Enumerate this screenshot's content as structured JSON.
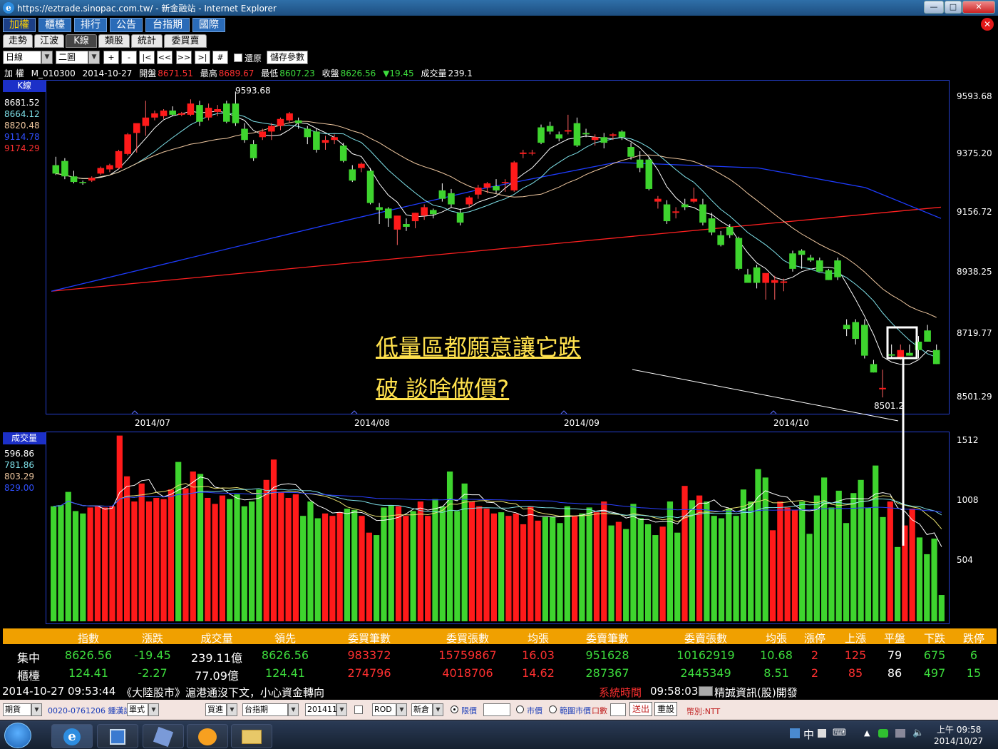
{
  "window": {
    "title": "https://eztrade.sinopac.com.tw/ - 新金融站 - Internet Explorer",
    "buttons": [
      "—",
      "□",
      "✕"
    ]
  },
  "main_tabs": [
    "加權",
    "櫃檯",
    "排行",
    "公告",
    "台指期",
    "國際"
  ],
  "sub_tabs": [
    "走勢",
    "江波",
    "K線",
    "類股",
    "統計",
    "委買賣"
  ],
  "toolbar": {
    "period": "日線",
    "layout": "二圖",
    "nav_buttons": [
      "+",
      "-",
      "|<",
      "<<",
      ">>",
      ">|",
      "#"
    ],
    "restore_label": "還原",
    "save_label": "儲存參數"
  },
  "info": {
    "name": "加 權",
    "code": "M_010300",
    "date": "2014-10-27",
    "open_label": "開盤",
    "open": "8671.51",
    "high_label": "最高",
    "high": "8689.67",
    "low_label": "最低",
    "low": "8607.23",
    "close_label": "收盤",
    "close": "8626.56",
    "change": "▼19.45",
    "vol_label": "成交量",
    "vol": "239.1"
  },
  "kline": {
    "label": "K線",
    "ma": [
      {
        "value": "8681.52",
        "color": "#ffffff"
      },
      {
        "value": "8664.12",
        "color": "#7ee0e8"
      },
      {
        "value": "8820.48",
        "color": "#f0c8a0"
      },
      {
        "value": "9114.78",
        "color": "#3050ff"
      },
      {
        "value": "9174.29",
        "color": "#ff3030"
      }
    ],
    "y_ticks": [
      "9593.68",
      "9375.20",
      "9156.72",
      "8938.25",
      "8719.77",
      "8501.29"
    ],
    "x_ticks": [
      "2014/07",
      "2014/08",
      "2014/09",
      "2014/10"
    ],
    "max_label": "9593.68",
    "min_label": "8501.2"
  },
  "volume": {
    "label": "成交量",
    "ma": [
      {
        "value": "596.86",
        "color": "#ffffff"
      },
      {
        "value": "781.86",
        "color": "#7ee0e8"
      },
      {
        "value": "803.29",
        "color": "#f0c8a0"
      },
      {
        "value": "829.00",
        "color": "#3050ff"
      }
    ],
    "y_ticks": [
      "1512",
      "1008",
      "504"
    ]
  },
  "annotation": {
    "line1": "低量區都願意讓它跌",
    "line2": "破 談啥做價?"
  },
  "stats": {
    "headers": [
      "指數",
      "漲跌",
      "成交量",
      "領先",
      "委買筆數",
      "委買張數",
      "均張",
      "委賣筆數",
      "委賣張數",
      "均張",
      "漲停",
      "上漲",
      "平盤",
      "下跌",
      "跌停"
    ],
    "rows": [
      {
        "name": "集中",
        "cells": [
          "8626.56",
          "-19.45",
          "239.11億",
          "8626.56",
          "983372",
          "15759867",
          "16.03",
          "951628",
          "10162919",
          "10.68",
          "2",
          "125",
          "79",
          "675",
          "6"
        ]
      },
      {
        "name": "櫃檯",
        "cells": [
          "124.41",
          "-2.27",
          "77.09億",
          "124.41",
          "274796",
          "4018706",
          "14.62",
          "287367",
          "2445349",
          "8.51",
          "2",
          "85",
          "86",
          "497",
          "15"
        ]
      }
    ]
  },
  "news": {
    "time": "2014-10-27 09:53:44",
    "text": "《大陸股市》滬港通沒下文，小心資金轉向",
    "sys_label": "系統時間",
    "sys_time": "09:58:03",
    "vendor": "精誠資訊(股)開發"
  },
  "order": {
    "type": "期貨",
    "account": "0020-0761206 鍾漢諾",
    "mode": "單式",
    "side": "買進",
    "product": "台指期",
    "month": "201411",
    "cond": "ROD",
    "pos": "新倉",
    "limit_label": "限價",
    "market_label": "市價",
    "range_label": "範圍市價",
    "qty_label": "口數",
    "submit": "送出",
    "reset": "重設",
    "currency": "幣別:NTT"
  },
  "taskbar": {
    "time": "上午 09:58",
    "date": "2014/10/27",
    "ime": "中"
  },
  "chart_data": [
    {
      "type": "candlestick",
      "title": "K線",
      "y_range": [
        8501.29,
        9593.68
      ],
      "x_ticks": [
        "2014/07",
        "2014/08",
        "2014/09",
        "2014/10"
      ],
      "y_ticks": [
        9593.68,
        9375.2,
        9156.72,
        8938.25,
        8719.77,
        8501.29
      ],
      "ohlc_note": "approximate daily candles read from chart",
      "candles": [
        [
          9330,
          9360,
          9295,
          9300
        ],
        [
          9345,
          9355,
          9280,
          9290
        ],
        [
          9290,
          9310,
          9265,
          9270
        ],
        [
          9270,
          9275,
          9260,
          9268
        ],
        [
          9275,
          9290,
          9270,
          9285
        ],
        [
          9300,
          9325,
          9295,
          9320
        ],
        [
          9315,
          9335,
          9305,
          9330
        ],
        [
          9320,
          9385,
          9315,
          9380
        ],
        [
          9370,
          9445,
          9365,
          9440
        ],
        [
          9445,
          9475,
          9375,
          9480
        ],
        [
          9470,
          9560,
          9435,
          9500
        ],
        [
          9500,
          9525,
          9490,
          9515
        ],
        [
          9505,
          9530,
          9495,
          9525
        ],
        [
          9525,
          9540,
          9505,
          9510
        ],
        [
          9510,
          9520,
          9505,
          9515
        ],
        [
          9510,
          9565,
          9505,
          9550
        ],
        [
          9545,
          9560,
          9470,
          9485
        ],
        [
          9500,
          9550,
          9490,
          9535
        ],
        [
          9520,
          9545,
          9505,
          9530
        ],
        [
          9550,
          9560,
          9480,
          9485
        ],
        [
          9550,
          9593,
          9470,
          9480
        ],
        [
          9460,
          9480,
          9410,
          9420
        ],
        [
          9405,
          9420,
          9345,
          9355
        ],
        [
          9430,
          9460,
          9420,
          9450
        ],
        [
          9450,
          9480,
          9420,
          9470
        ],
        [
          9470,
          9500,
          9455,
          9495
        ],
        [
          9490,
          9520,
          9480,
          9515
        ],
        [
          9490,
          9500,
          9460,
          9480
        ],
        [
          9460,
          9470,
          9405,
          9430
        ],
        [
          9450,
          9460,
          9375,
          9385
        ],
        [
          9410,
          9435,
          9385,
          9420
        ],
        [
          9420,
          9440,
          9405,
          9430
        ],
        [
          9400,
          9410,
          9340,
          9345
        ],
        [
          9315,
          9330,
          9270,
          9275
        ],
        [
          9320,
          9340,
          9305,
          9335
        ],
        [
          9310,
          9320,
          9190,
          9195
        ],
        [
          9180,
          9195,
          9120,
          9170
        ],
        [
          9175,
          9180,
          9110,
          9140
        ],
        [
          9100,
          9140,
          9045,
          9150
        ],
        [
          9120,
          9140,
          9095,
          9110
        ],
        [
          9130,
          9160,
          9105,
          9160
        ],
        [
          9150,
          9190,
          9135,
          9180
        ],
        [
          9170,
          9175,
          9140,
          9155
        ],
        [
          9240,
          9265,
          9200,
          9210
        ],
        [
          9230,
          9245,
          9180,
          9190
        ],
        [
          9160,
          9175,
          9115,
          9125
        ],
        [
          9190,
          9220,
          9180,
          9215
        ],
        [
          9225,
          9260,
          9210,
          9250
        ],
        [
          9250,
          9270,
          9230,
          9265
        ],
        [
          9255,
          9280,
          9230,
          9240
        ],
        [
          9270,
          9280,
          9235,
          9270
        ],
        [
          9240,
          9345,
          9235,
          9340
        ],
        [
          9370,
          9385,
          9355,
          9375
        ],
        [
          9375,
          9385,
          9365,
          9375
        ],
        [
          9465,
          9475,
          9405,
          9410
        ],
        [
          9470,
          9485,
          9440,
          9450
        ],
        [
          9440,
          9450,
          9415,
          9425
        ],
        [
          9450,
          9510,
          9440,
          9455
        ],
        [
          9480,
          9500,
          9395,
          9400
        ],
        [
          9445,
          9460,
          9430,
          9440
        ],
        [
          9420,
          9440,
          9400,
          9430
        ],
        [
          9430,
          9445,
          9390,
          9410
        ],
        [
          9435,
          9445,
          9420,
          9440
        ],
        [
          9450,
          9455,
          9420,
          9430
        ],
        [
          9395,
          9410,
          9350,
          9360
        ],
        [
          9350,
          9380,
          9305,
          9320
        ],
        [
          9350,
          9360,
          9240,
          9245
        ],
        [
          9200,
          9220,
          9175,
          9210
        ],
        [
          9190,
          9205,
          9120,
          9130
        ],
        [
          9160,
          9180,
          9140,
          9165
        ],
        [
          9190,
          9210,
          9170,
          9180
        ],
        [
          9200,
          9250,
          9195,
          9210
        ],
        [
          9190,
          9210,
          9115,
          9125
        ],
        [
          9140,
          9160,
          9080,
          9090
        ],
        [
          9080,
          9095,
          9040,
          9045
        ],
        [
          9110,
          9120,
          9070,
          9080
        ],
        [
          9070,
          9075,
          8955,
          8960
        ],
        [
          8940,
          8960,
          8910,
          8910
        ],
        [
          8965,
          8975,
          8890,
          8910
        ],
        [
          8910,
          8920,
          8850,
          8945
        ],
        [
          8910,
          8935,
          8850,
          8920
        ],
        [
          8910,
          8925,
          8880,
          8915
        ],
        [
          9015,
          9025,
          8950,
          8960
        ],
        [
          9025,
          9030,
          8960,
          9010
        ],
        [
          9000,
          9010,
          8985,
          8990
        ],
        [
          8990,
          9000,
          8950,
          8950
        ],
        [
          8955,
          8960,
          8920,
          8920
        ],
        [
          8990,
          9000,
          8920,
          8930
        ],
        [
          8760,
          8780,
          8720,
          8745
        ],
        [
          8770,
          8780,
          8690,
          8710
        ],
        [
          8760,
          8780,
          8640,
          8650
        ],
        [
          8620,
          8635,
          8590,
          8590
        ],
        [
          8530,
          8600,
          8501,
          8535
        ],
        [
          8655,
          8690,
          8640,
          8650
        ],
        [
          8640,
          8690,
          8635,
          8670
        ],
        [
          8660,
          8690,
          8650,
          8650
        ],
        [
          8700,
          8720,
          8640,
          8670
        ],
        [
          8740,
          8760,
          8700,
          8700
        ],
        [
          8670,
          8690,
          8620,
          8620
        ]
      ]
    },
    {
      "type": "bar",
      "title": "成交量",
      "y_range": [
        0,
        1512
      ],
      "y_ticks": [
        1512,
        1008,
        504
      ],
      "values": [
        960,
        970,
        1080,
        920,
        900,
        950,
        960,
        950,
        960,
        1550,
        1210,
        1000,
        1150,
        1000,
        1030,
        1020,
        1100,
        1330,
        1110,
        1250,
        1230,
        1030,
        980,
        1050,
        1020,
        1060,
        960,
        1000,
        1100,
        1180,
        1350,
        1080,
        1030,
        1060,
        880,
        1000,
        860,
        900,
        880,
        910,
        940,
        930,
        880,
        740,
        720,
        950,
        970,
        960,
        880,
        920,
        1000,
        880,
        1020,
        960,
        1250,
        920,
        1150,
        1000,
        960,
        940,
        900,
        910,
        880,
        900,
        810,
        960,
        840,
        870,
        870,
        820,
        960,
        880,
        900,
        950,
        910,
        1000,
        800,
        830,
        770,
        980,
        860,
        810,
        720,
        790,
        1000,
        740,
        1130,
        1010,
        1050,
        1000,
        880,
        860,
        940,
        880,
        1100,
        1000,
        1270,
        1200,
        760,
        1000,
        950,
        930,
        1000,
        730,
        1050,
        1200,
        950,
        1090,
        820,
        1070,
        1180,
        950,
        1300,
        870,
        1000,
        620,
        800,
        940,
        700,
        560,
        690,
        220
      ],
      "ma_labels": [
        "596.86",
        "781.86",
        "803.29",
        "829.00"
      ]
    }
  ]
}
